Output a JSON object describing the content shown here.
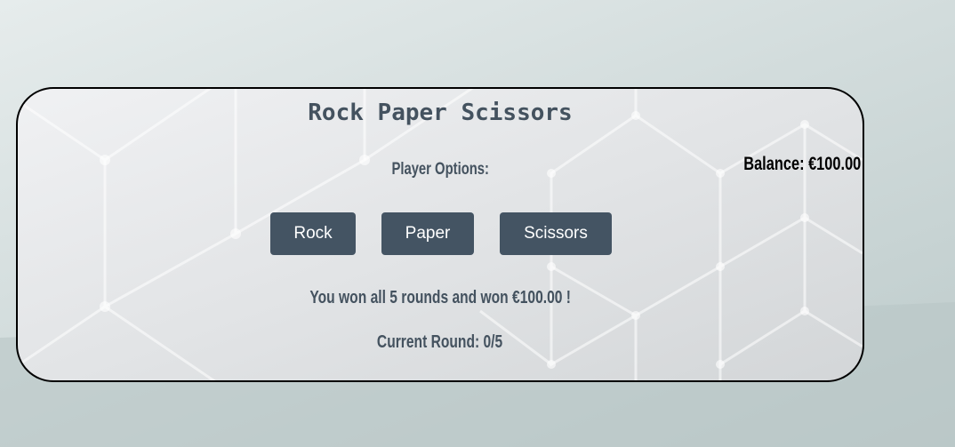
{
  "game": {
    "title": "Rock Paper Scissors",
    "player_options_label": "Player Options:",
    "balance": "Balance: €100.00",
    "buttons": {
      "rock": "Rock",
      "paper": "Paper",
      "scissors": "Scissors"
    },
    "result_message": "You won all 5 rounds and won €100.00 !",
    "current_round": "Current Round: 0/5"
  },
  "colors": {
    "button": "#445463",
    "text": "#44525f",
    "border": "#000000"
  }
}
